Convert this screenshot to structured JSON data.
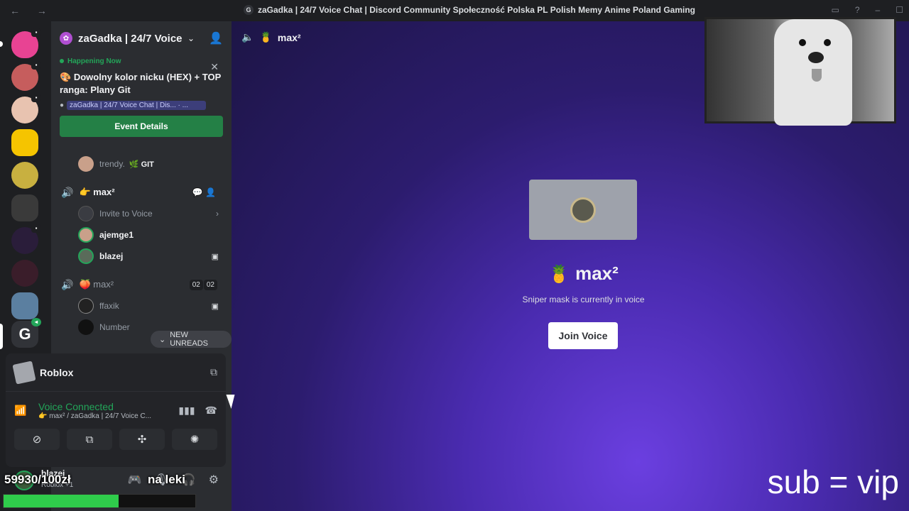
{
  "window": {
    "title": "zaGadka | 24/7 Voice Chat | Discord Community Społeczność Polska PL Polish Memy Anime Poland Gaming",
    "nav": "← →",
    "title_icon": "G"
  },
  "server": {
    "name": "zaGadka | 24/7 Voice...",
    "chevron": "⌄"
  },
  "event": {
    "status": "Happening Now",
    "title": "Dowolny kolor nicku (HEX) + TOP ranga: Plany Git",
    "location": "zaGadka | 24/7 Voice Chat | Dis... · ...",
    "button": "Event Details",
    "close": "✕"
  },
  "members_top": [
    {
      "name": "trendy.",
      "tag": "GIT"
    }
  ],
  "voice_channels": [
    {
      "name": "max²",
      "emoji": "👉",
      "active": true,
      "invite_label": "Invite to Voice",
      "members": [
        {
          "name": "ajemge1"
        },
        {
          "name": "blazej"
        }
      ]
    },
    {
      "name": "max²",
      "emoji": "🍑",
      "active": false,
      "count_a": "02",
      "count_b": "02",
      "members": [
        {
          "name": "ffaxik"
        },
        {
          "name": "Number"
        }
      ]
    }
  ],
  "new_unreads": "NEW UNREADS",
  "activity": {
    "name": "Roblox"
  },
  "voice_status": {
    "title": "Voice Connected",
    "detail": "👉 max² / zaGadka | 24/7 Voice C..."
  },
  "user": {
    "name": "blazej",
    "sub": "Roblox +1"
  },
  "stage": {
    "channel_name": "max²",
    "channel_emoji": "🍍",
    "title": "max²",
    "subtitle": "Sniper mask is currently in voice",
    "join": "Join Voice"
  },
  "overlay": {
    "vip": "sub = vip",
    "goal": "59930/100zł",
    "mid": "na leki",
    "goal_progress": 0.6
  },
  "colors": {
    "accent_green": "#23a559",
    "event_button": "#248046",
    "stage_purple": "#4a2bb0"
  }
}
